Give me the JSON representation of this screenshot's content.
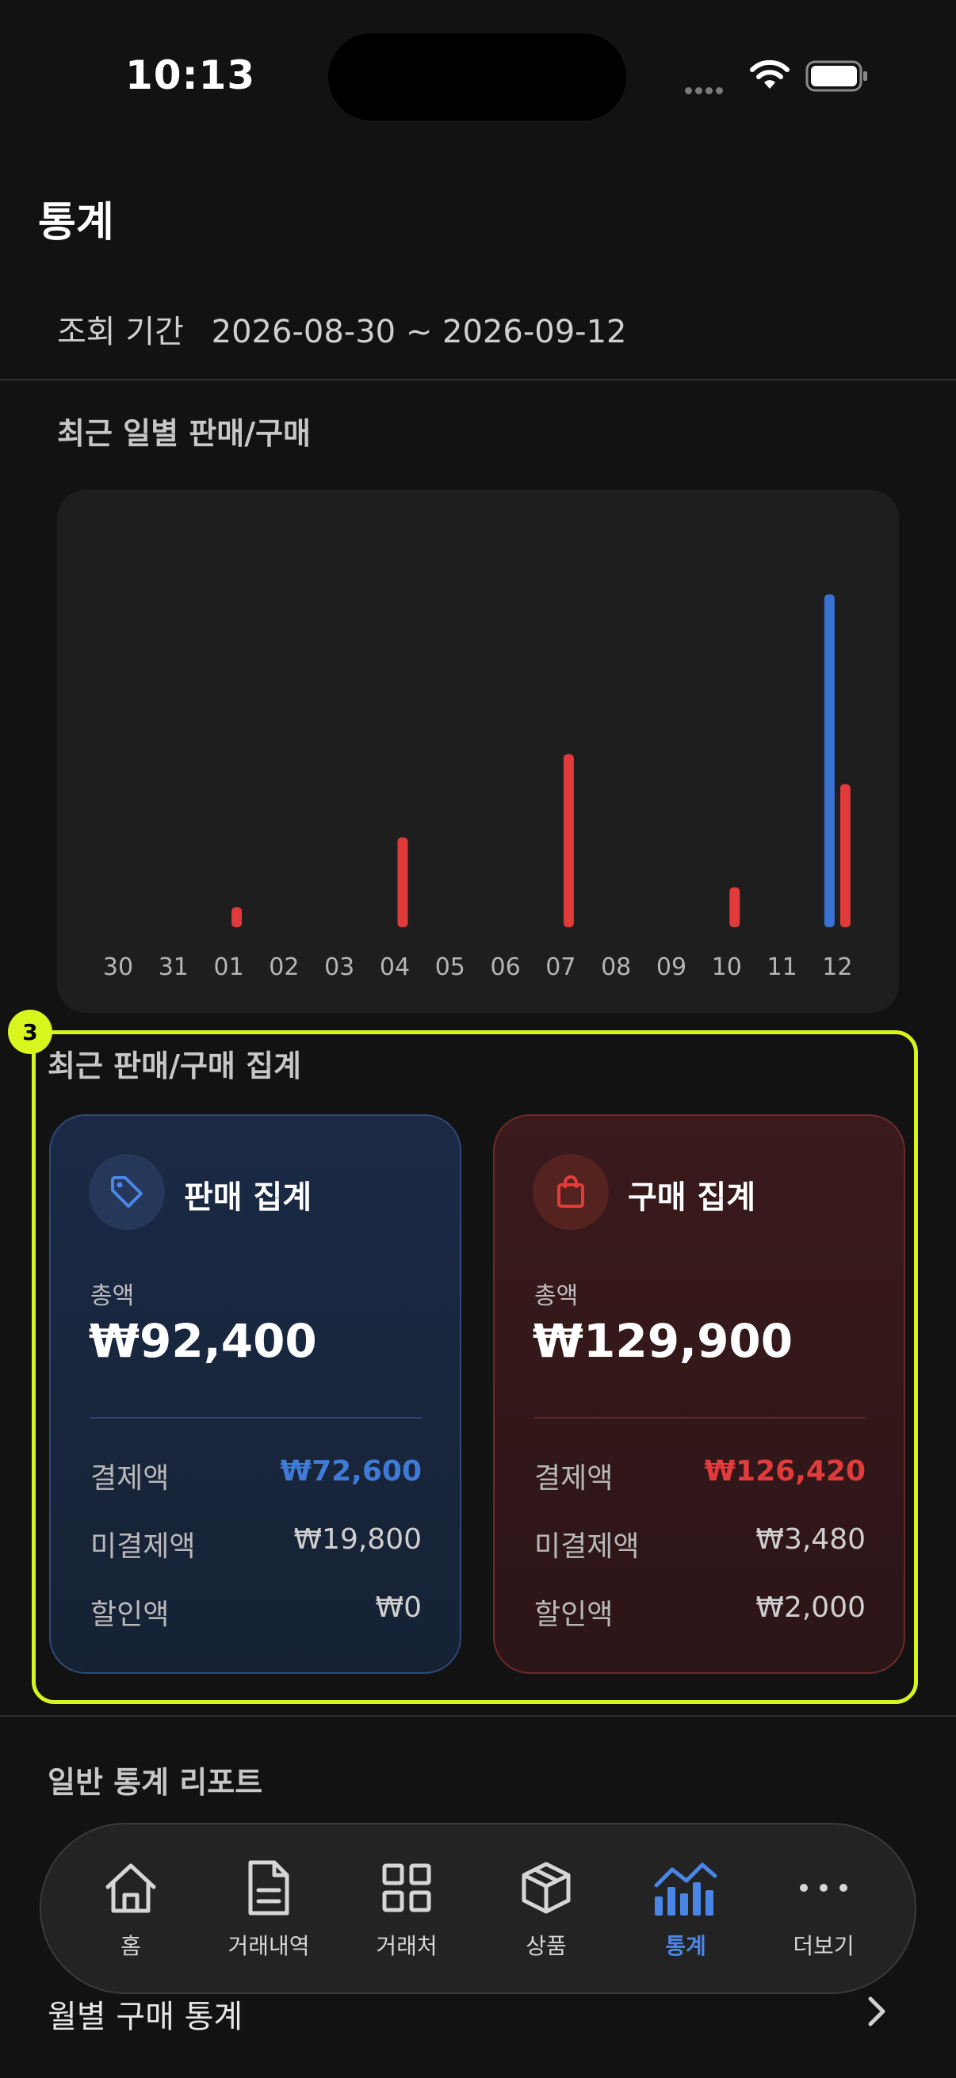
{
  "status_bar": {
    "time": "10:13"
  },
  "header": {
    "title": "통계"
  },
  "period": {
    "label": "조회 기간",
    "value": "2026-08-30 ~ 2026-09-12"
  },
  "daily_section": {
    "title": "최근 일별 판매/구매"
  },
  "chart_data": {
    "type": "bar",
    "categories": [
      "30",
      "31",
      "01",
      "02",
      "03",
      "04",
      "05",
      "06",
      "07",
      "08",
      "09",
      "10",
      "11",
      "12"
    ],
    "series": [
      {
        "values": [
          0,
          0,
          0,
          0,
          0,
          0,
          0,
          0,
          0,
          0,
          0,
          0,
          0,
          100
        ],
        "color": "#3a72d1"
      },
      {
        "values": [
          0,
          0,
          6,
          0,
          0,
          27,
          0,
          0,
          52,
          0,
          0,
          12,
          0,
          43
        ],
        "color": "#e03a3a"
      }
    ]
  },
  "summary": {
    "badge": "3",
    "title": "최근 판매/구매 집계",
    "sale": {
      "title": "판매 집계",
      "icon": "tag-icon",
      "total_label": "총액",
      "total": "₩92,400",
      "rows": [
        {
          "label": "결제액",
          "value": "₩72,600"
        },
        {
          "label": "미결제액",
          "value": "₩19,800"
        },
        {
          "label": "할인액",
          "value": "₩0"
        }
      ]
    },
    "buy": {
      "title": "구매 집계",
      "icon": "shopping-bag-icon",
      "total_label": "총액",
      "total": "₩129,900",
      "rows": [
        {
          "label": "결제액",
          "value": "₩126,420"
        },
        {
          "label": "미결제액",
          "value": "₩3,480"
        },
        {
          "label": "할인액",
          "value": "₩2,000"
        }
      ]
    }
  },
  "report": {
    "title": "일반 통계 리포트",
    "item": "월별 구매 통계"
  },
  "tabs": [
    {
      "label": "홈",
      "icon": "home-icon"
    },
    {
      "label": "거래내역",
      "icon": "document-icon"
    },
    {
      "label": "거래처",
      "icon": "grid-icon"
    },
    {
      "label": "상품",
      "icon": "box-icon"
    },
    {
      "label": "통계",
      "icon": "chart-icon",
      "active": true
    },
    {
      "label": "더보기",
      "icon": "more-icon"
    }
  ]
}
